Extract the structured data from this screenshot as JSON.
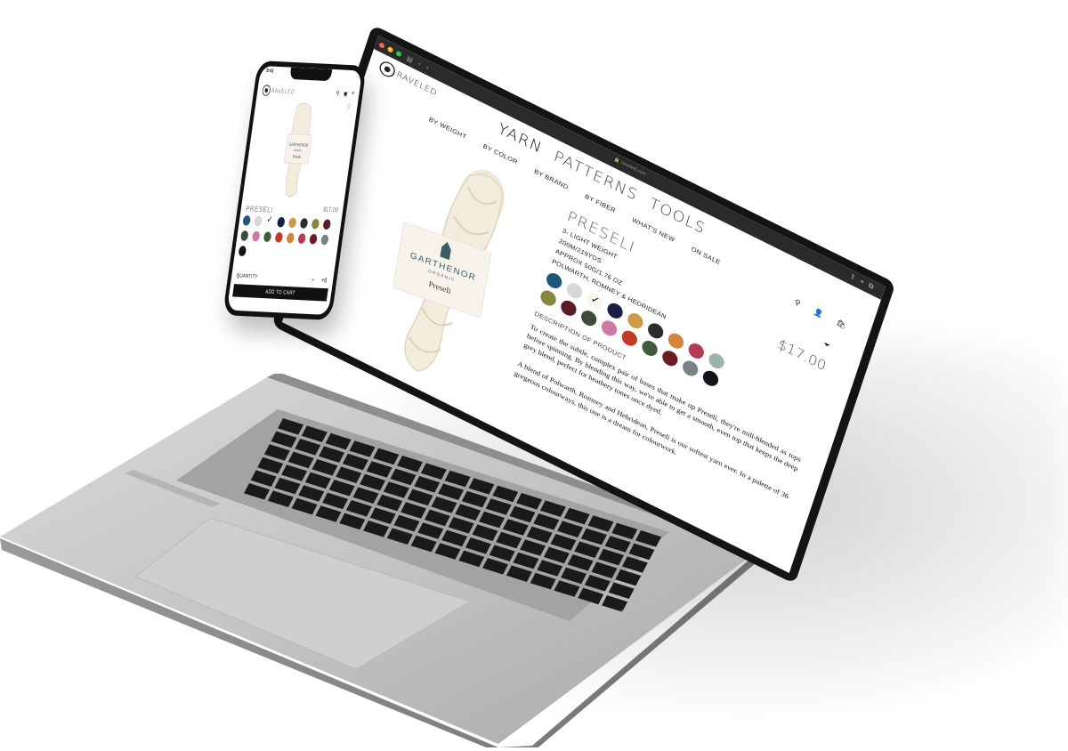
{
  "desktop": {
    "address": "raveled.com",
    "brand": "RAVELED",
    "top_nav": [
      {
        "label": "YARN",
        "active": true
      },
      {
        "label": "PATTERNS",
        "active": false
      },
      {
        "label": "TOOLS",
        "active": false
      }
    ],
    "sub_nav": [
      "BY WEIGHT",
      "BY COLOR",
      "BY BRAND",
      "BY FIBER",
      "WHAT'S NEW",
      "ON SALE"
    ],
    "product": {
      "title": "PRESELI",
      "price": "$17.00",
      "specs": [
        "3- LIGHT WEIGHT",
        "200M/219YDS",
        "APPROX 50G/1.76 OZ",
        "POLWARTH, ROMNEY & HEDRIDEAN"
      ],
      "label_brand": "GARTHENOR",
      "label_sub": "ORGANIC",
      "label_name": "Preseli",
      "description_title": "DESCRIPTION OF PRODUCT",
      "description_1": "To create the subtle, complex pair of bases that make up Preseli, they're mill-blended as tops before spinning. By blending this way, we're able to get a smooth, even top that keeps the deep grey blend, perfect for heathery tones once dyed.",
      "description_2": "A blend of Polwarth, Romney and Hebridean, Preseli is our softest yarn ever. In a palette of 36 gorgeous colourways, this one is a dream for colourwork."
    }
  },
  "mobile": {
    "time": "9:41",
    "brand": "RAVELED",
    "title": "PRESELI",
    "price": "$17.00",
    "quantity_label": "QUANTITY",
    "qty_minus": "–",
    "qty_plus": "+6",
    "add_to_cart": "ADD TO CART"
  },
  "swatch_colors_desktop": [
    "#1e5878",
    "#d7d7d7",
    "selected",
    "#1b1f44",
    "#cf9a45",
    "#2a2f2c",
    "#d6843a",
    "#b23d55",
    "#9db3a8",
    "#88873c",
    "#5a1d24",
    "#3b4d3a",
    "#cd7aa3",
    "#c03c24",
    "#3f5b3a",
    "#6a1d24",
    "#7a8286",
    "#111418"
  ],
  "swatch_colors_mobile": [
    "#1e5878",
    "#d7d7d7",
    "selected",
    "#1b1f44",
    "#cf9a45",
    "#2a2f2c",
    "#88873c",
    "#5a1d24",
    "#3b4d3a",
    "#cd7aa3",
    "#3f5b3a",
    "#c03c24",
    "#d6843a",
    "#b23d55",
    "#6a1d24",
    "#7a8286",
    "#111418"
  ]
}
